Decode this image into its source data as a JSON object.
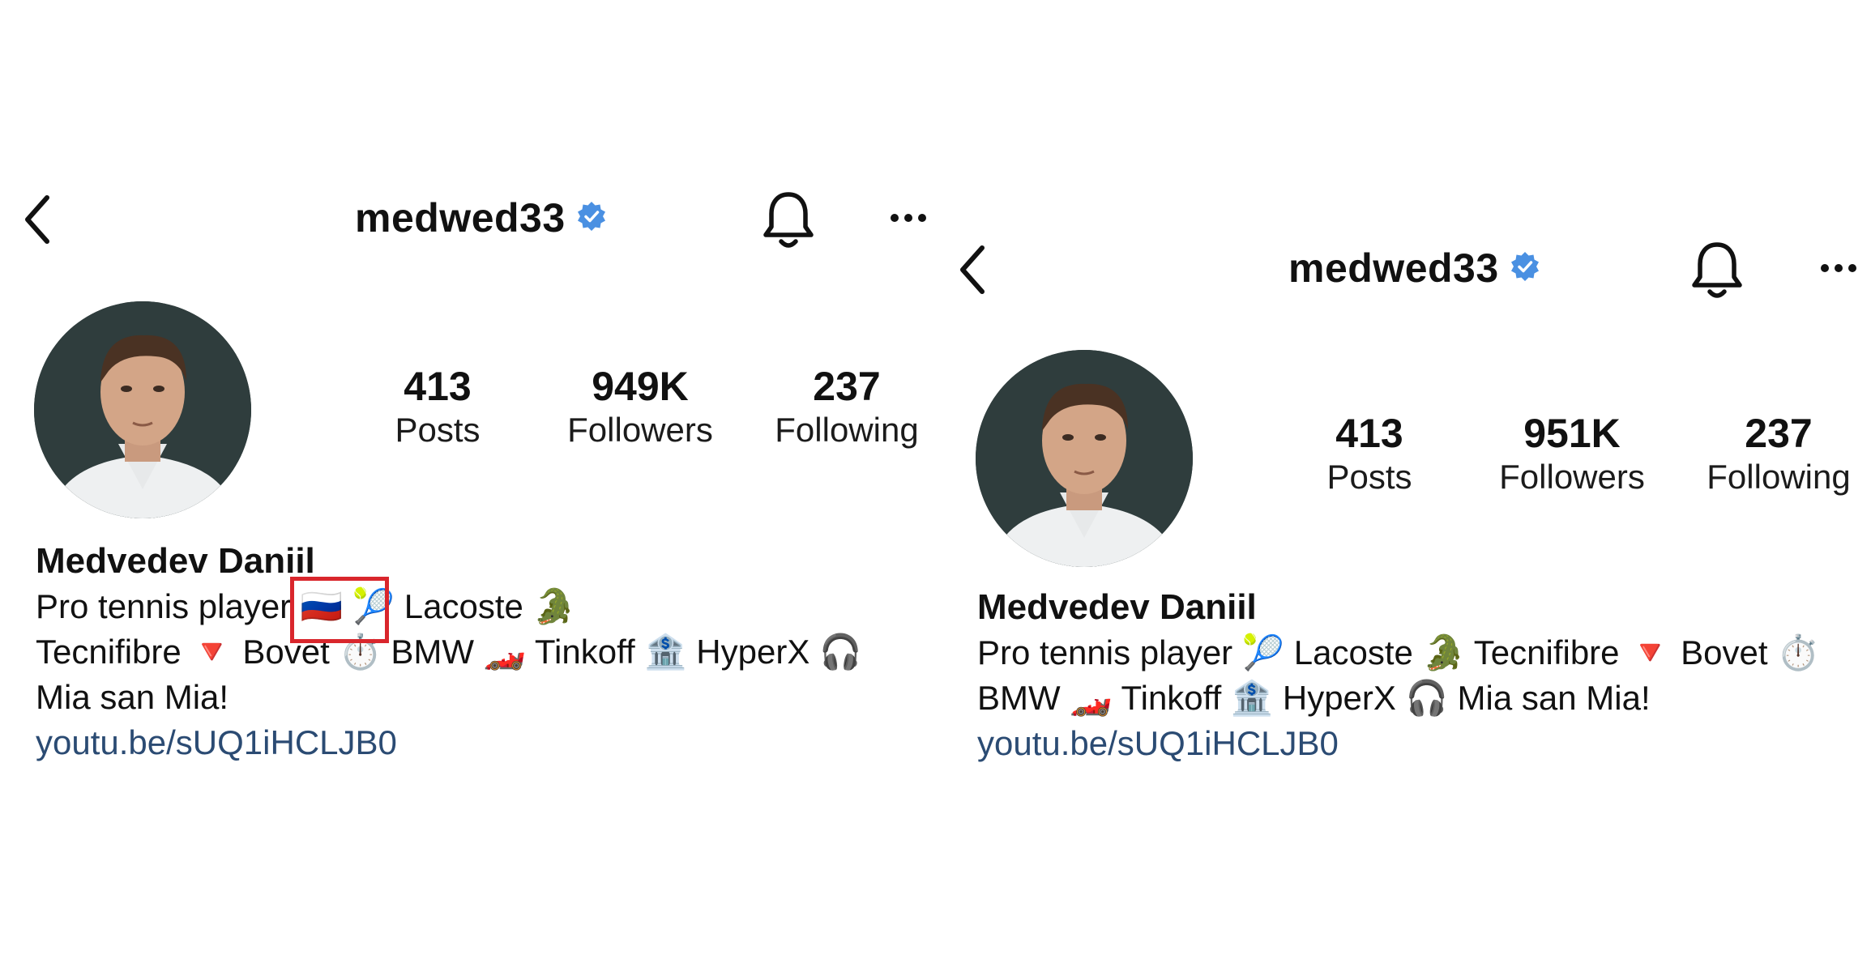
{
  "left": {
    "header": {
      "username": "medwed33"
    },
    "stats": [
      {
        "value": "413",
        "label": "Posts"
      },
      {
        "value": "949K",
        "label": "Followers"
      },
      {
        "value": "237",
        "label": "Following"
      }
    ],
    "bio": {
      "name": "Medvedev Daniil",
      "lines": [
        "Pro tennis player 🇷🇺 🎾 Lacoste 🐊",
        "Tecnifibre 🔻 Bovet ⏱️ BMW 🏎️ Tinkoff 🏦 HyperX 🎧",
        "Mia san Mia!"
      ],
      "link": "youtu.be/sUQ1iHCLJB0"
    }
  },
  "right": {
    "header": {
      "username": "medwed33"
    },
    "stats": [
      {
        "value": "413",
        "label": "Posts"
      },
      {
        "value": "951K",
        "label": "Followers"
      },
      {
        "value": "237",
        "label": "Following"
      }
    ],
    "bio": {
      "name": "Medvedev Daniil",
      "lines": [
        "Pro tennis player 🎾 Lacoste 🐊 Tecnifibre 🔻 Bovet ⏱️",
        "BMW 🏎️ Tinkoff 🏦 HyperX 🎧 Mia san Mia!"
      ],
      "link": "youtu.be/sUQ1iHCLJB0"
    }
  },
  "colors": {
    "verified_badge": "#4a90e2",
    "link": "#2b4b73",
    "highlight_box": "#d9262c"
  },
  "icons": [
    "back-arrow-icon",
    "verified-badge-icon",
    "bell-icon",
    "more-dots-icon"
  ]
}
